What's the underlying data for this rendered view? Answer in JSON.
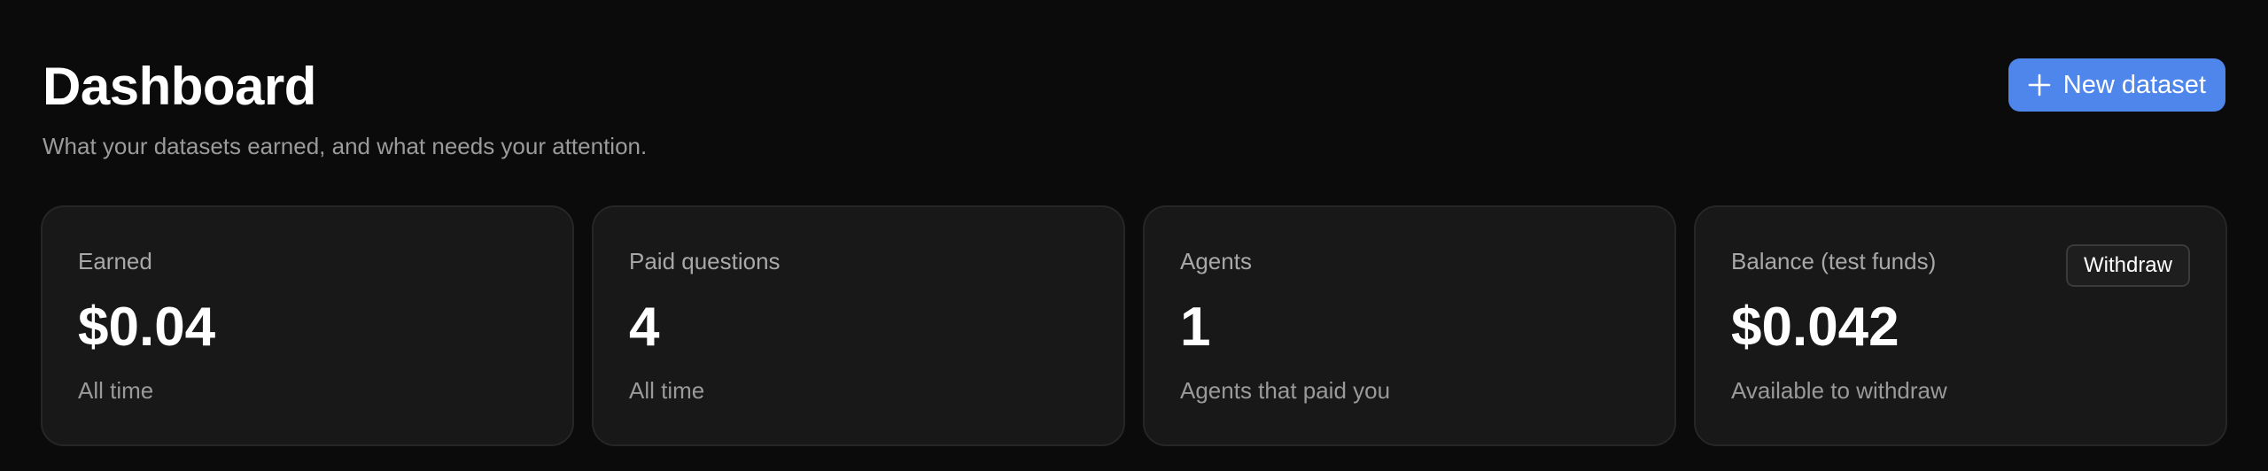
{
  "header": {
    "title": "Dashboard",
    "subtitle": "What your datasets earned, and what needs your attention.",
    "new_dataset_label": "New dataset"
  },
  "cards": [
    {
      "label": "Earned",
      "value": "$0.04",
      "note": "All time"
    },
    {
      "label": "Paid questions",
      "value": "4",
      "note": "All time"
    },
    {
      "label": "Agents",
      "value": "1",
      "note": "Agents that paid you"
    },
    {
      "label": "Balance (test funds)",
      "value": "$0.042",
      "note": "Available to withdraw",
      "action_label": "Withdraw"
    }
  ],
  "colors": {
    "background": "#0b0b0b",
    "card": "#181818",
    "accent": "#4f86ec"
  },
  "icons": {
    "new_dataset": "plus-icon"
  }
}
